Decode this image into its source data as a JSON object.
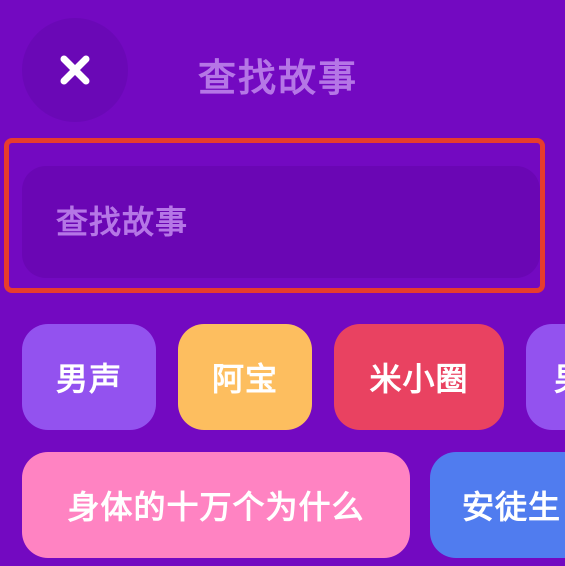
{
  "header": {
    "title": "查找故事",
    "close_icon": "close-x-icon"
  },
  "search": {
    "placeholder": "查找故事",
    "value": ""
  },
  "tags": [
    {
      "label": "男声",
      "color": "#9352ef"
    },
    {
      "label": "阿宝",
      "color": "#fdbe5f"
    },
    {
      "label": "米小圈",
      "color": "#e94261"
    },
    {
      "label": "男",
      "color": "#9352ef"
    },
    {
      "label": "身体的十万个为什么",
      "color": "#ff83c2"
    },
    {
      "label": "安徒生",
      "color": "#507cef"
    }
  ],
  "colors": {
    "background": "#7309c1",
    "highlight_outline": "#e73c2e",
    "muted_text": "#b576e6"
  }
}
